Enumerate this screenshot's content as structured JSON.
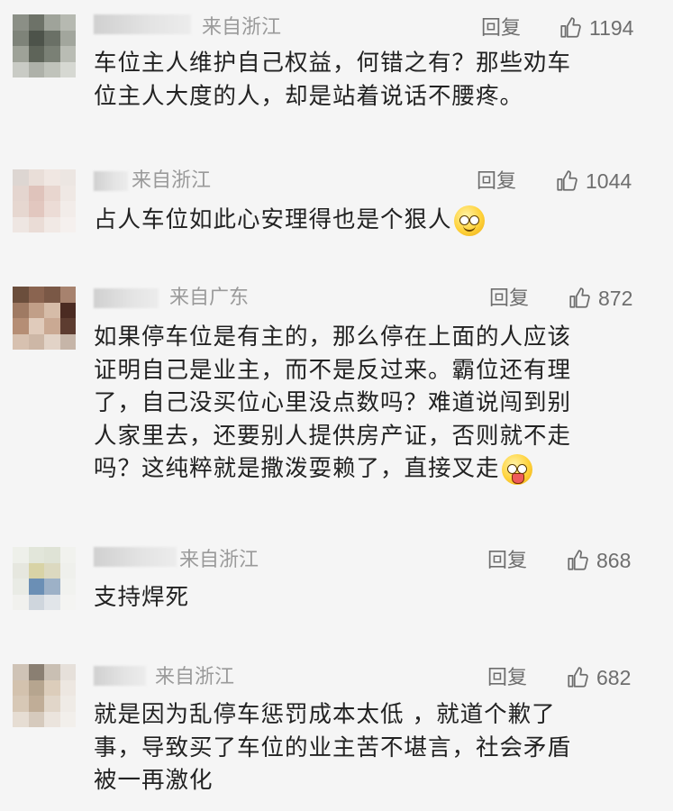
{
  "comments": [
    {
      "location": "来自浙江",
      "reply_label": "回复",
      "like_count": "1194",
      "lines": [
        "车位主人维护自己权益，何错之有？那些劝车",
        "位主人大度的人，却是站着说话不腰疼。"
      ]
    },
    {
      "location": "来自浙江",
      "reply_label": "回复",
      "like_count": "1044",
      "lines": [
        "占人车位如此心安理得也是个狠人"
      ],
      "emoji": "slightly-smiling-face-emoji"
    },
    {
      "location": "来自广东",
      "reply_label": "回复",
      "like_count": "872",
      "lines": [
        "如果停车位是有主的，那么停在上面的人应该",
        "证明自己是业主，而不是反过来。霸位还有理",
        "了，自己没买位心里没点数吗？难道说闯到别",
        "人家里去，还要别人提供房产证，否则就不走",
        "吗？这纯粹就是撒泼耍赖了，直接叉走"
      ],
      "emoji": "tongue-out-face-emoji"
    },
    {
      "location": "来自浙江",
      "reply_label": "回复",
      "like_count": "868",
      "lines": [
        "支持焊死"
      ]
    },
    {
      "location": "来自浙江",
      "reply_label": "回复",
      "like_count": "682",
      "lines": [
        "就是因为乱停车惩罚成本太低 ，就道个歉了",
        "事，导致买了车位的业主苦不堪言，社会矛盾",
        "被一再激化"
      ]
    }
  ],
  "icons": {
    "like": "thumbs-up-icon"
  },
  "colors": {
    "background": "#f5f5f5",
    "meta_text": "#9a9a9a",
    "action_text": "#6e6e6e",
    "body_text": "#222222"
  }
}
